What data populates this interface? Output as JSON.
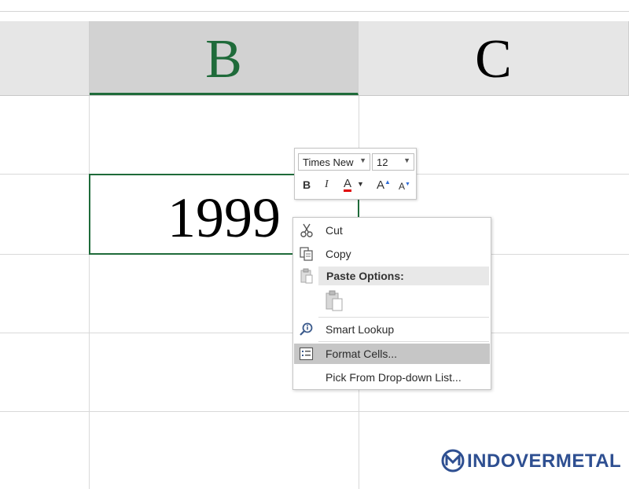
{
  "columns": [
    {
      "letter": "B",
      "selected": true
    },
    {
      "letter": "C",
      "selected": false
    }
  ],
  "cell": {
    "value": "1999"
  },
  "mini_toolbar": {
    "font_name": "Times New",
    "font_size": "12",
    "bold": "B",
    "italic": "I",
    "font_color": "A",
    "grow_font": "A",
    "shrink_font": "A"
  },
  "context_menu": {
    "cut": "Cut",
    "copy": "Copy",
    "paste_options": "Paste Options:",
    "smart_lookup": "Smart Lookup",
    "format_cells": "Format Cells...",
    "pick_list": "Pick From Drop-down List..."
  },
  "watermark": {
    "brand": "INDOVERMETAL"
  },
  "colors": {
    "accent_green": "#1f6b3a",
    "font_color_red": "#e00000",
    "hover_gray": "#c6c6c6",
    "brand_blue": "#2e4f91"
  },
  "icons": [
    "scissors-icon",
    "copy-icon",
    "clipboard-icon",
    "paste-icon",
    "smart-lookup-icon",
    "format-cells-icon"
  ]
}
